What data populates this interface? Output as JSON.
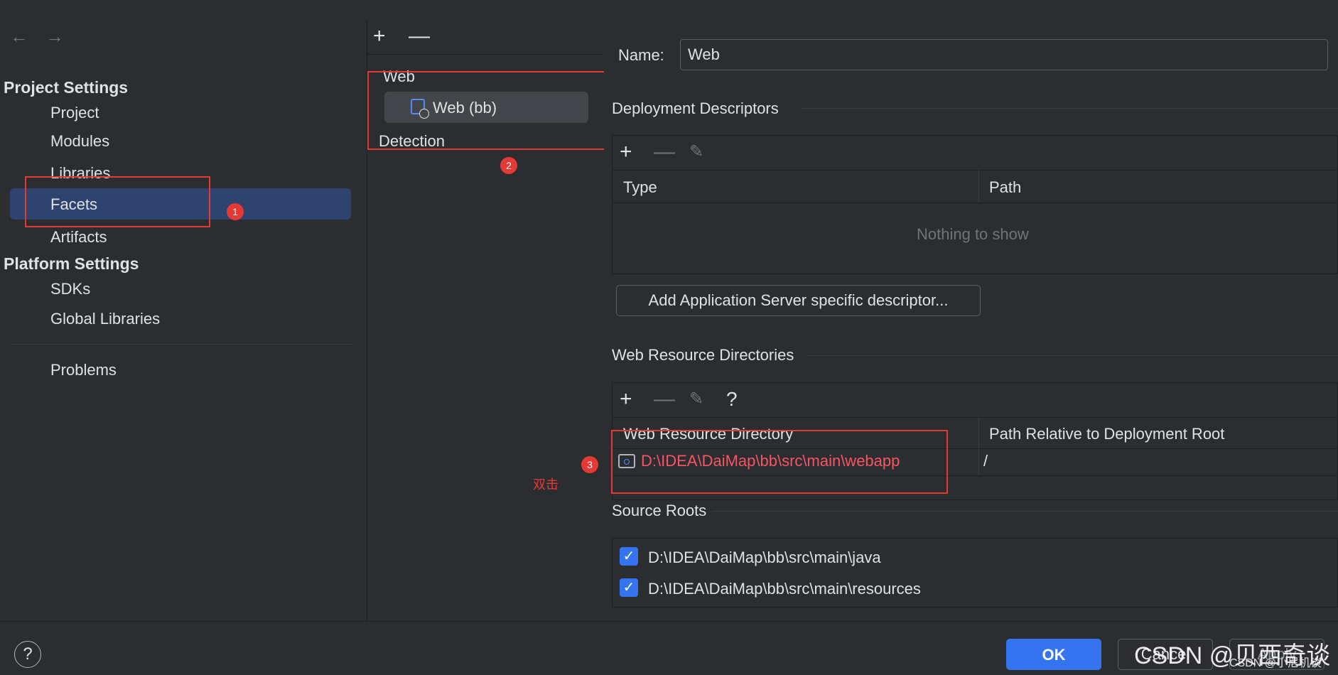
{
  "nav": {
    "back_icon": "arrow-left-icon",
    "forward_icon": "arrow-right-icon",
    "project_settings_title": "Project Settings",
    "project_items": [
      "Project",
      "Modules",
      "Libraries",
      "Facets",
      "Artifacts"
    ],
    "platform_settings_title": "Platform Settings",
    "platform_items": [
      "SDKs",
      "Global Libraries"
    ],
    "problems": "Problems"
  },
  "middle": {
    "add_icon": "plus-icon",
    "remove_icon": "minus-icon",
    "group_label": "Web",
    "facet_item": "Web (bb)",
    "detection": "Detection"
  },
  "annotations": {
    "badge1": "1",
    "badge2": "2",
    "badge3": "3",
    "double_click": "双击",
    "color": "#e53935"
  },
  "right": {
    "name_label": "Name:",
    "name_value": "Web",
    "deployment_title": "Deployment Descriptors",
    "deployment_columns": [
      "Type",
      "Path"
    ],
    "deployment_empty": "Nothing to show",
    "add_descriptor_button": "Add Application Server specific descriptor...",
    "web_resource_title": "Web Resource Directories",
    "help_glyph": "?",
    "web_resource_columns": [
      "Web Resource Directory",
      "Path Relative to Deployment Root"
    ],
    "web_resource_rows": [
      {
        "directory": "D:\\IDEA\\DaiMap\\bb\\src\\main\\webapp",
        "relative": "/"
      }
    ],
    "source_roots_title": "Source Roots",
    "source_roots": [
      {
        "path": "D:\\IDEA\\DaiMap\\bb\\src\\main\\java",
        "checked": true
      },
      {
        "path": "D:\\IDEA\\DaiMap\\bb\\src\\main\\resources",
        "checked": true
      }
    ]
  },
  "footer": {
    "help": "?",
    "ok": "OK",
    "cancel": "Cancel",
    "apply": "Apply",
    "watermark": "CSDN @贝西奇谈",
    "watermark_small": "CSDN @小尼机谈"
  },
  "colors": {
    "background": "#2b2d30",
    "selection": "#2e436e",
    "accent": "#3574f0",
    "error_text": "#f75464"
  }
}
